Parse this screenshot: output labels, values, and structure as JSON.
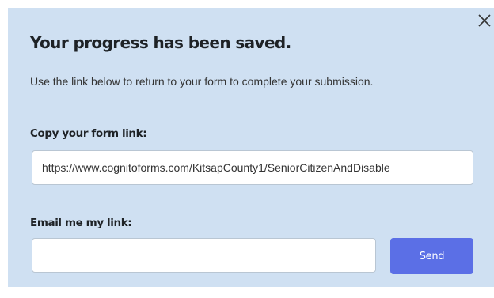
{
  "dialog": {
    "title": "Your progress has been saved.",
    "description": "Use the link below to return to your form to complete your submission.",
    "close_icon": "close-icon"
  },
  "copy_link": {
    "label": "Copy your form link:",
    "value": "https://www.cognitoforms.com/KitsapCounty1/SeniorCitizenAndDisable"
  },
  "email_link": {
    "label": "Email me my link:",
    "value": "",
    "placeholder": "",
    "send_label": "Send"
  },
  "colors": {
    "dialog_background": "#cfe0f2",
    "send_button": "#5b6fe6"
  }
}
